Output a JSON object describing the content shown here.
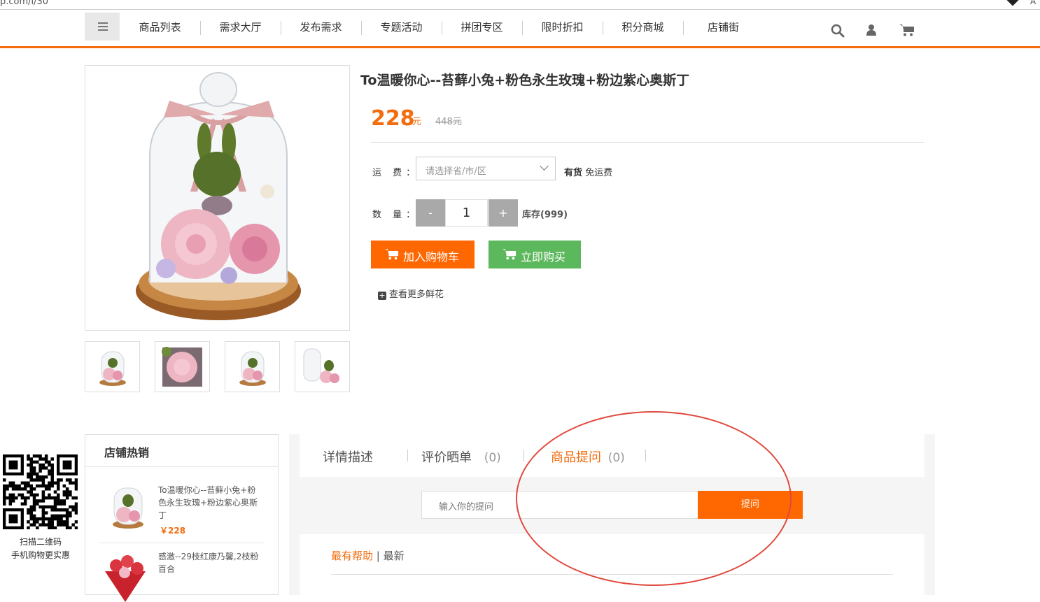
{
  "browser": {
    "url": "p.com/i/30",
    "extension_label": "A"
  },
  "nav": {
    "items": [
      "商品列表",
      "需求大厅",
      "发布需求",
      "专题活动",
      "拼团专区",
      "限时折扣",
      "积分商城",
      "店铺街"
    ],
    "icons": [
      "search-icon",
      "user-icon",
      "cart-icon"
    ]
  },
  "product": {
    "title": "To温暖你心--苔藓小兔+粉色永生玫瑰+粉边紫心奥斯丁",
    "price": "228",
    "price_unit": "元",
    "original_price": "448元",
    "shipping_label": "运 费：",
    "region_placeholder": "请选择省/市/区",
    "availability": "有货",
    "free_shipping": "免运费",
    "quantity_label": "数 量：",
    "quantity": "1",
    "minus": "-",
    "plus": "+",
    "stock": "库存(999)",
    "add_to_cart": "加入购物车",
    "buy_now": "立即购买",
    "see_more": "查看更多鲜花"
  },
  "qr": {
    "line1": "扫描二维码",
    "line2": "手机购物更实惠"
  },
  "hot_sales": {
    "title": "店铺热销",
    "items": [
      {
        "name": "To温暖你心--苔藓小兔+粉色永生玫瑰+粉边紫心奥斯丁",
        "price": "￥228"
      },
      {
        "name": "感激--29枝红康乃馨,2枝粉百合",
        "price": ""
      }
    ]
  },
  "tabs": {
    "items": [
      {
        "label": "详情描述",
        "count": ""
      },
      {
        "label": "评价晒单",
        "count": "(0)"
      },
      {
        "label": "商品提问",
        "count": "(0)"
      }
    ],
    "active": "商品提问",
    "ask_placeholder": "输入你的提问",
    "ask_button": "提问",
    "sort_helpful": "最有帮助",
    "sort_sep": "|",
    "sort_newest": "最新"
  },
  "colors": {
    "accent": "#f36c0d",
    "buy_green": "#5cb85c",
    "annotation": "#e0483c"
  }
}
